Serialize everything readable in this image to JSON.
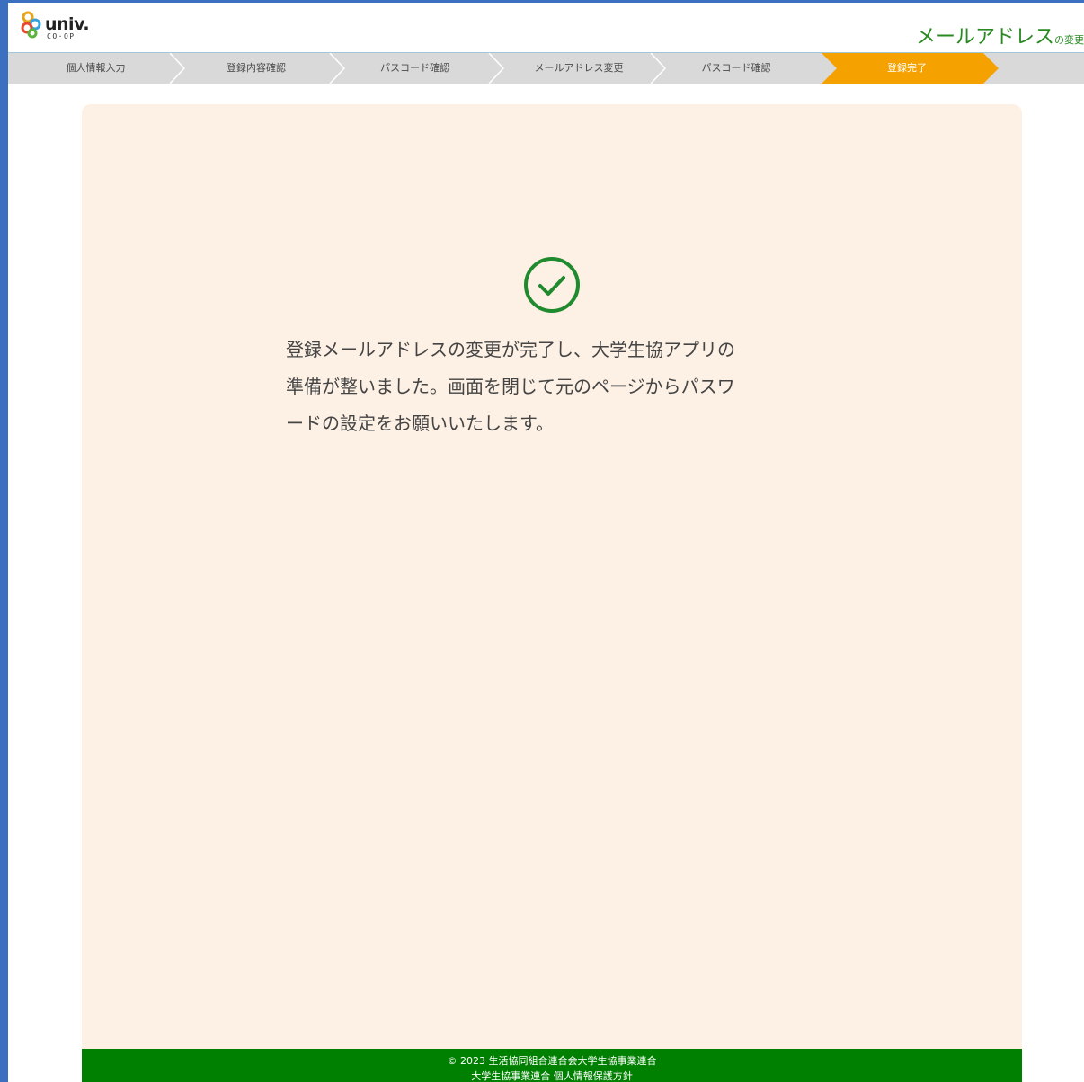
{
  "header": {
    "logo_text": "univ.",
    "logo_sub": "CO·OP",
    "page_title": "メールアドレス",
    "page_title_small": "の変更"
  },
  "steps": [
    {
      "label": "個人情報入力",
      "active": false
    },
    {
      "label": "登録内容確認",
      "active": false
    },
    {
      "label": "パスコード確認",
      "active": false
    },
    {
      "label": "メールアドレス変更",
      "active": false
    },
    {
      "label": "パスコード確認",
      "active": false
    },
    {
      "label": "登録完了",
      "active": true
    }
  ],
  "main": {
    "status_icon": "check-circle-icon",
    "message_lines": [
      "登録メールアドレスの変更が完了し、大学生協アプリの",
      "準備が整いました。画面を閉じて元のページからパスワ",
      "ードの設定をお願いいたします。"
    ]
  },
  "footer": {
    "copyright": "© 2023 生活協同組合連合会大学生協事業連合",
    "line2": "大学生協事業連合 個人情報保護方針"
  },
  "colors": {
    "brand_green": "#2a8a22",
    "footer_green": "#008000",
    "active_step": "#f5a100",
    "card_bg": "#fdf0e4",
    "frame_blue": "#3b6fbf"
  }
}
